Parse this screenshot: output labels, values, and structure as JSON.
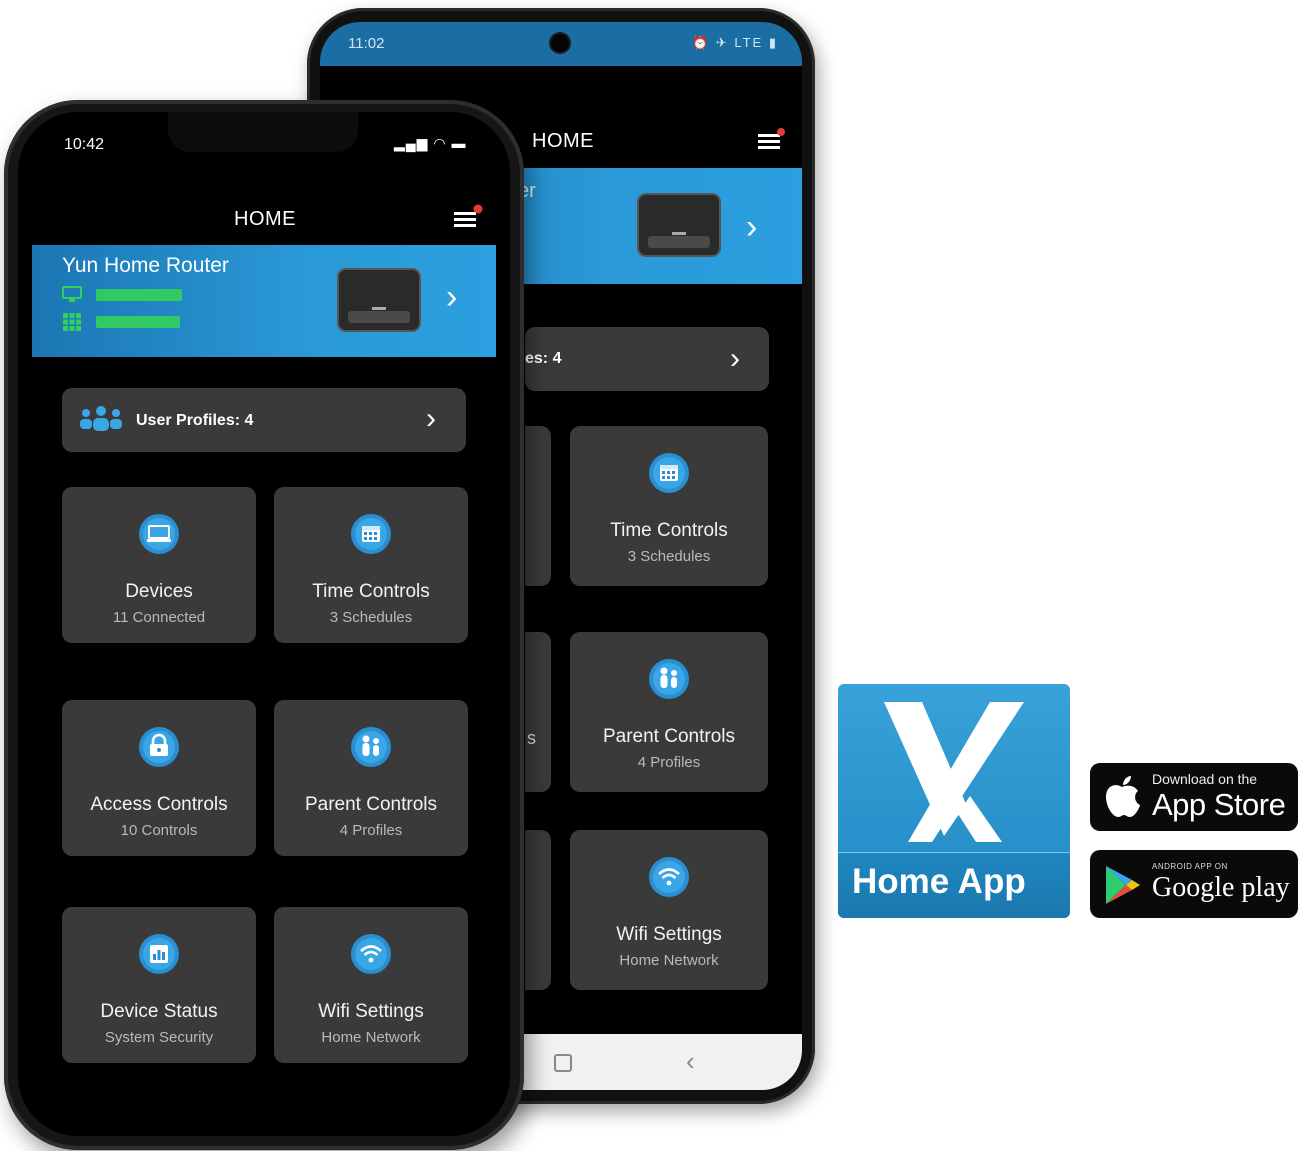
{
  "back_phone": {
    "status_time": "11:02",
    "status_icons": "⏰ ✈ LTE ▮",
    "header_title": "HOME",
    "banner_fragment": "er",
    "profiles_fragment": "es: 4",
    "cards": [
      {
        "title": "Time Controls",
        "subtitle": "3 Schedules",
        "icon": "calendar-icon"
      },
      {
        "title": "Parent Controls",
        "subtitle": "4 Profiles",
        "icon": "family-icon"
      },
      {
        "title": "Wifi Settings",
        "subtitle": "Home Network",
        "icon": "wifi-icon"
      }
    ],
    "partial_card_fragment": "s"
  },
  "front_phone": {
    "status_time": "10:42",
    "status_icons": "▂▄▆ ◠ ▬",
    "header_title": "HOME",
    "router_name": "Yun Home Router",
    "user_profiles": "User Profiles: 4",
    "cards": [
      {
        "title": "Devices",
        "subtitle": "11 Connected",
        "icon": "devices-icon"
      },
      {
        "title": "Time Controls",
        "subtitle": "3 Schedules",
        "icon": "calendar-icon"
      },
      {
        "title": "Access Controls",
        "subtitle": "10 Controls",
        "icon": "lock-icon"
      },
      {
        "title": "Parent Controls",
        "subtitle": "4 Profiles",
        "icon": "family-icon"
      },
      {
        "title": "Device Status",
        "subtitle": "System Security",
        "icon": "status-icon"
      },
      {
        "title": "Wifi Settings",
        "subtitle": "Home Network",
        "icon": "wifi-icon"
      }
    ]
  },
  "logo": {
    "letter": "X",
    "label": "Home App"
  },
  "badges": {
    "appstore_small": "Download on the",
    "appstore_large": "App Store",
    "googleplay_small": "ANDROID APP ON",
    "googleplay_large": "Google play"
  },
  "colors": {
    "accent_blue": "#2a9ad7",
    "card_bg": "#3a3a3a",
    "notification_red": "#e53935",
    "status_green": "#34d15a"
  }
}
